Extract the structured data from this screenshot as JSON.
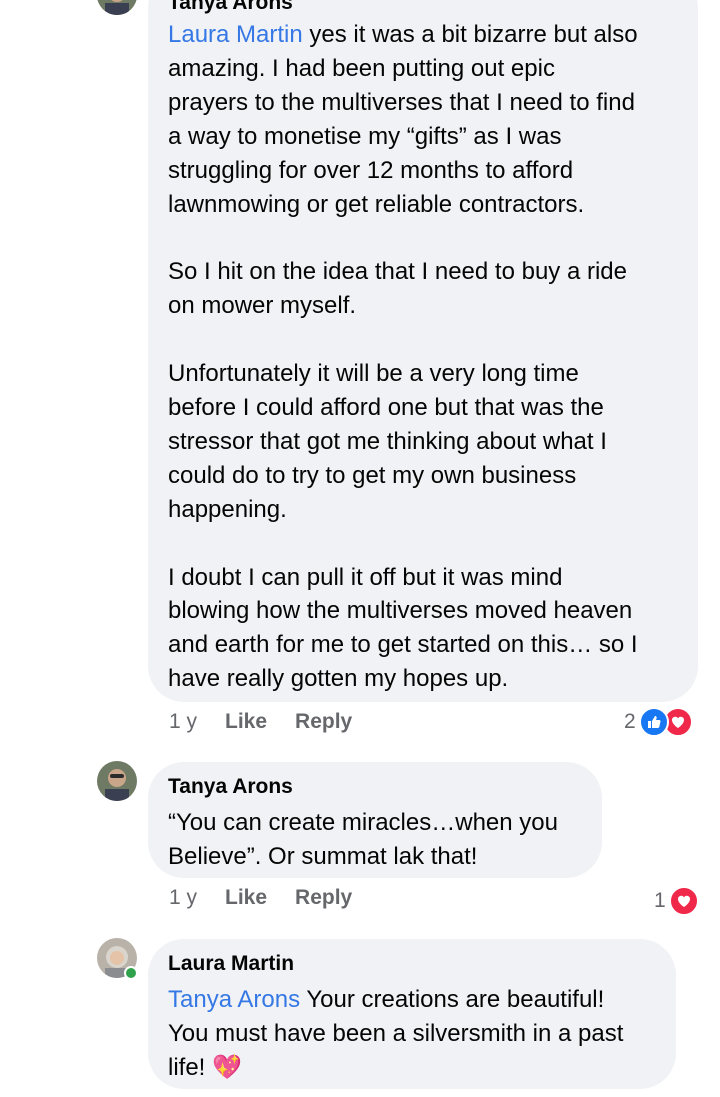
{
  "comments": [
    {
      "author": "Tanya Arons",
      "mention": "Laura Martin",
      "text": " yes it was a bit bizarre but also\namazing.   I had been putting out epic\nprayers to the multiverses that I need to find\na way to monetise my “gifts” as I was\nstruggling for over 12 months to afford\nlawnmowing or get reliable contractors.\n\nSo I hit on the idea that I need to buy a ride\non mower myself.\n\nUnfortunately it will be a very long time\nbefore I could afford one but that was the\nstressor that got me thinking about what I\ncould do to try to get my own business\nhappening.\n\nI doubt I can pull it off but it was mind\nblowing how the multiverses moved heaven\nand earth for me to get started on this… so I\nhave really gotten my hopes up.",
      "time": "1 y",
      "like": "Like",
      "reply": "Reply",
      "reaction_count": "2"
    },
    {
      "author": "Tanya Arons",
      "text": "“You can create miracles…when you\nBelieve”. Or summat lak that!",
      "time": "1 y",
      "like": "Like",
      "reply": "Reply",
      "reaction_count": "1"
    },
    {
      "author": "Laura Martin",
      "mention": "Tanya Arons",
      "text": " Your creations are beautiful!\nYou must have been a silversmith in a past\nlife! 💖"
    }
  ],
  "colors": {
    "mention": "#3578e5",
    "bubble": "#f0f2f5",
    "meta": "#65676b",
    "like_reaction": "#1877f2",
    "love_reaction": "#f02849",
    "online": "#31a24c"
  },
  "icons": {
    "like_reaction": "thumbs-up-icon",
    "love_reaction": "heart-icon"
  }
}
